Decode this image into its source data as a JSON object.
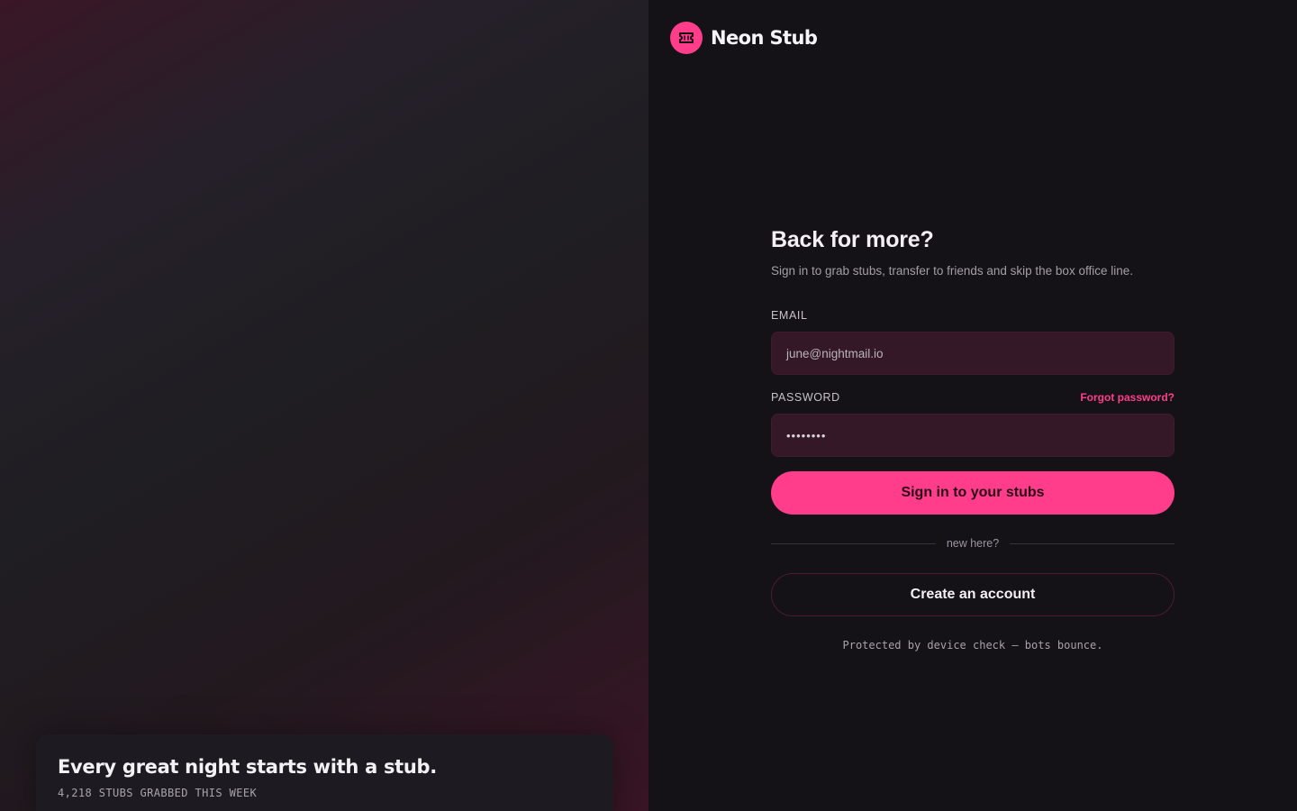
{
  "hero": {
    "title": "Every great night starts with a stub.",
    "stat": "4,218 STUBS GRABBED THIS WEEK"
  },
  "brand": {
    "name": "Neon Stub",
    "logo_icon": "ticket-icon",
    "accent_color": "#FF3D8B"
  },
  "form": {
    "heading": "Back for more?",
    "subtitle": "Sign in to grab stubs, transfer to friends and skip the box office line.",
    "email_label": "EMAIL",
    "email_value": "june@nightmail.io",
    "password_label": "PASSWORD",
    "forgot_label": "Forgot password?",
    "password_value": "••••••••",
    "submit_label": "Sign in to your stubs",
    "divider_text": "new here?",
    "create_label": "Create an account",
    "footnote": "Protected by device check — bots bounce."
  }
}
